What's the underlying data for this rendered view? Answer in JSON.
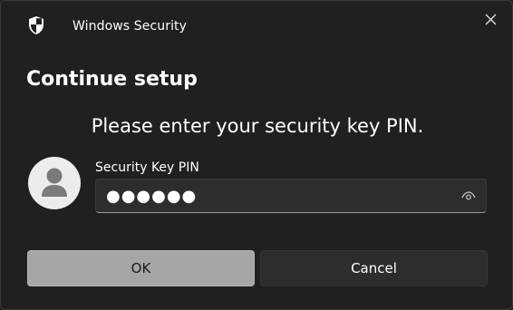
{
  "window": {
    "title": "Windows Security",
    "icons": {
      "app": "shield-icon",
      "close": "close-icon"
    }
  },
  "dialog": {
    "heading": "Continue setup",
    "prompt": "Please enter your security key PIN."
  },
  "pin": {
    "label": "Security Key PIN",
    "value": "●●●●●●",
    "icons": {
      "avatar": "user-avatar-icon",
      "reveal": "eye-icon"
    }
  },
  "buttons": {
    "ok": "OK",
    "cancel": "Cancel"
  },
  "colors": {
    "background": "#202020",
    "ok_button": "#a6a6a6",
    "cancel_button": "#2d2d2d",
    "input_background": "#2d2d2d",
    "avatar_background": "#ececec",
    "avatar_figure": "#7a7a7a"
  }
}
